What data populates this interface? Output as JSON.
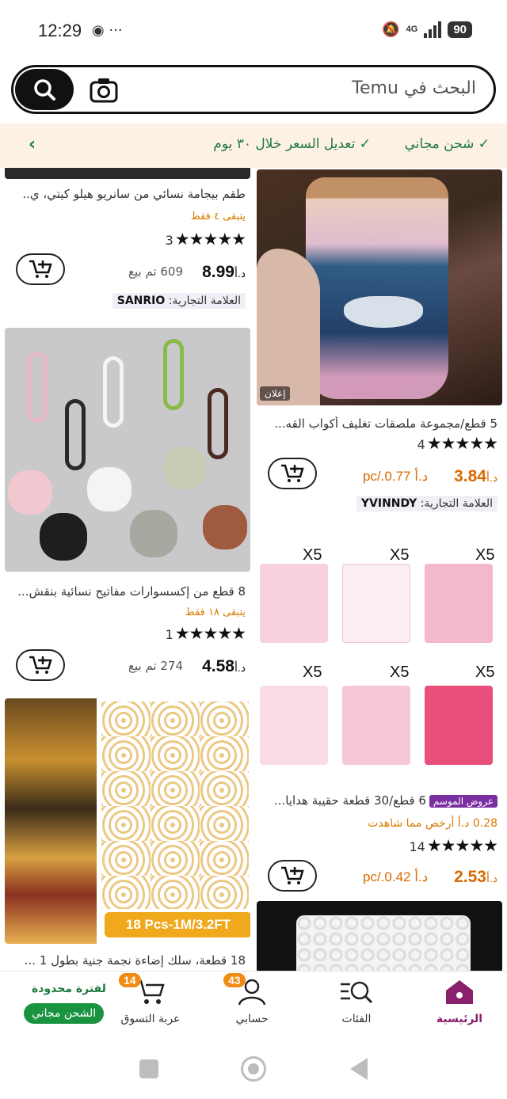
{
  "status": {
    "time": "12:29",
    "battery": "90",
    "network": "4G"
  },
  "search": {
    "placeholder": "البحث في Temu"
  },
  "benefits": {
    "free_shipping": "شحن مجاني",
    "price_adjust": "تعديل السعر خلال ٣٠ يوم"
  },
  "products": {
    "pajama": {
      "title": "طقم بيجامة نسائي من سانريو هيلو كيتي، ي..",
      "stock": "يتبقى ٤ فقط",
      "stars": "★★★★★",
      "reviews": "3",
      "price": "8.99",
      "currency": "د.أ",
      "sold": "609 تم بيع",
      "brand_label": "العلامة التجارية:",
      "brand_name": "SANRIO"
    },
    "cup": {
      "ad_label": "إعلان",
      "title": "5 قطع/مجموعة ملصقات تغليف أكواب القه...",
      "stars": "★★★★★",
      "reviews": "4",
      "price": "3.84",
      "currency": "د.أ",
      "per_pc": "pc/.د.أ 0.77",
      "brand_label": "العلامة التجارية:",
      "brand_name": "YVINNDY"
    },
    "keychain": {
      "title": "8 قطع من إكسسوارات مفاتيح نسائية بنقش...",
      "stock": "يتبقى ١٨ فقط",
      "stars": "★★★★★",
      "reviews": "1",
      "price": "4.58",
      "currency": "د.أ",
      "sold": "274 تم بيع"
    },
    "bags": {
      "x5_label": "X5",
      "season_tag": "عروض الموسم",
      "title": "6 قطع/30 قطعة حقيبة هدايا...",
      "cheaper": "0.28 د.أ أرخص مما شاهدت",
      "stars": "★★★★★",
      "reviews": "14",
      "price": "2.53",
      "currency": "د.أ",
      "per_pc": "pc/.د.أ 0.42"
    },
    "lights": {
      "tag": "18 Pcs-1M/3.2FT",
      "title": "18 قطعة، سلك إضاءة نجمة جنية بطول 1 ..."
    }
  },
  "nav": {
    "home": "الرئيسية",
    "categories": "الفئات",
    "account": "حسابي",
    "account_badge": "43",
    "cart": "عربة التسوق",
    "cart_badge": "14",
    "limited": "لفترة محدودة",
    "free_shipping": "الشحن مجاني"
  },
  "colors": {
    "accent_green": "#1d7a3c",
    "banner_bg": "#fdf0e4",
    "price_orange": "#d96a00",
    "active_purple": "#8a1f6b",
    "badge_orange": "#f08a12"
  }
}
